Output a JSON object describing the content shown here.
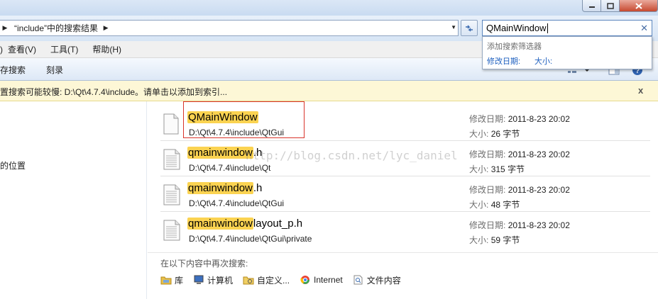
{
  "address": {
    "breadcrumb": "“include”中的搜索结果"
  },
  "search": {
    "value": "QMainWindow",
    "clear_icon": "close-icon"
  },
  "filter_popup": {
    "title": "添加搜索筛选器",
    "filters": [
      "修改日期:",
      "大小:"
    ]
  },
  "menu": {
    "items": [
      ")",
      "查看(V)",
      "工具(T)",
      "帮助(H)"
    ]
  },
  "toolbar": {
    "buttons": [
      "存搜索",
      "刻录"
    ]
  },
  "infobar": {
    "text": "置搜索可能较慢: D:\\Qt\\4.7.4\\include。请单击以添加到索引...",
    "close": "x"
  },
  "nav": {
    "label": "的位置"
  },
  "results": [
    {
      "highlight": "QMainWindow",
      "rest": "",
      "path": "D:\\Qt\\4.7.4\\include\\QtGui",
      "date_label": "修改日期:",
      "date": "2011-8-23 20:02",
      "size_label": "大小:",
      "size": "26 字节"
    },
    {
      "highlight": "qmainwindow",
      "rest": ".h",
      "path": "D:\\Qt\\4.7.4\\include\\Qt",
      "date_label": "修改日期:",
      "date": "2011-8-23 20:02",
      "size_label": "大小:",
      "size": "315 字节"
    },
    {
      "highlight": "qmainwindow",
      "rest": ".h",
      "path": "D:\\Qt\\4.7.4\\include\\QtGui",
      "date_label": "修改日期:",
      "date": "2011-8-23 20:02",
      "size_label": "大小:",
      "size": "48 字节"
    },
    {
      "highlight": "qmainwindow",
      "rest": "layout_p.h",
      "path": "D:\\Qt\\4.7.4\\include\\QtGui\\private",
      "date_label": "修改日期:",
      "date": "2011-8-23 20:02",
      "size_label": "大小:",
      "size": "59 字节"
    }
  ],
  "watermark": "http://blog.csdn.net/lyc_daniel",
  "search_again": {
    "label": "在以下内容中再次搜索:",
    "locations": [
      {
        "label": "库",
        "icon": "library-icon"
      },
      {
        "label": "计算机",
        "icon": "computer-icon"
      },
      {
        "label": "自定义...",
        "icon": "custom-folder-icon"
      },
      {
        "label": "Internet",
        "icon": "internet-icon"
      },
      {
        "label": "文件内容",
        "icon": "file-content-icon"
      }
    ]
  },
  "colors": {
    "highlight": "#fbd351",
    "link": "#1d5fbf",
    "selection_box": "#d9342b",
    "infobar": "#fdf7d6"
  }
}
